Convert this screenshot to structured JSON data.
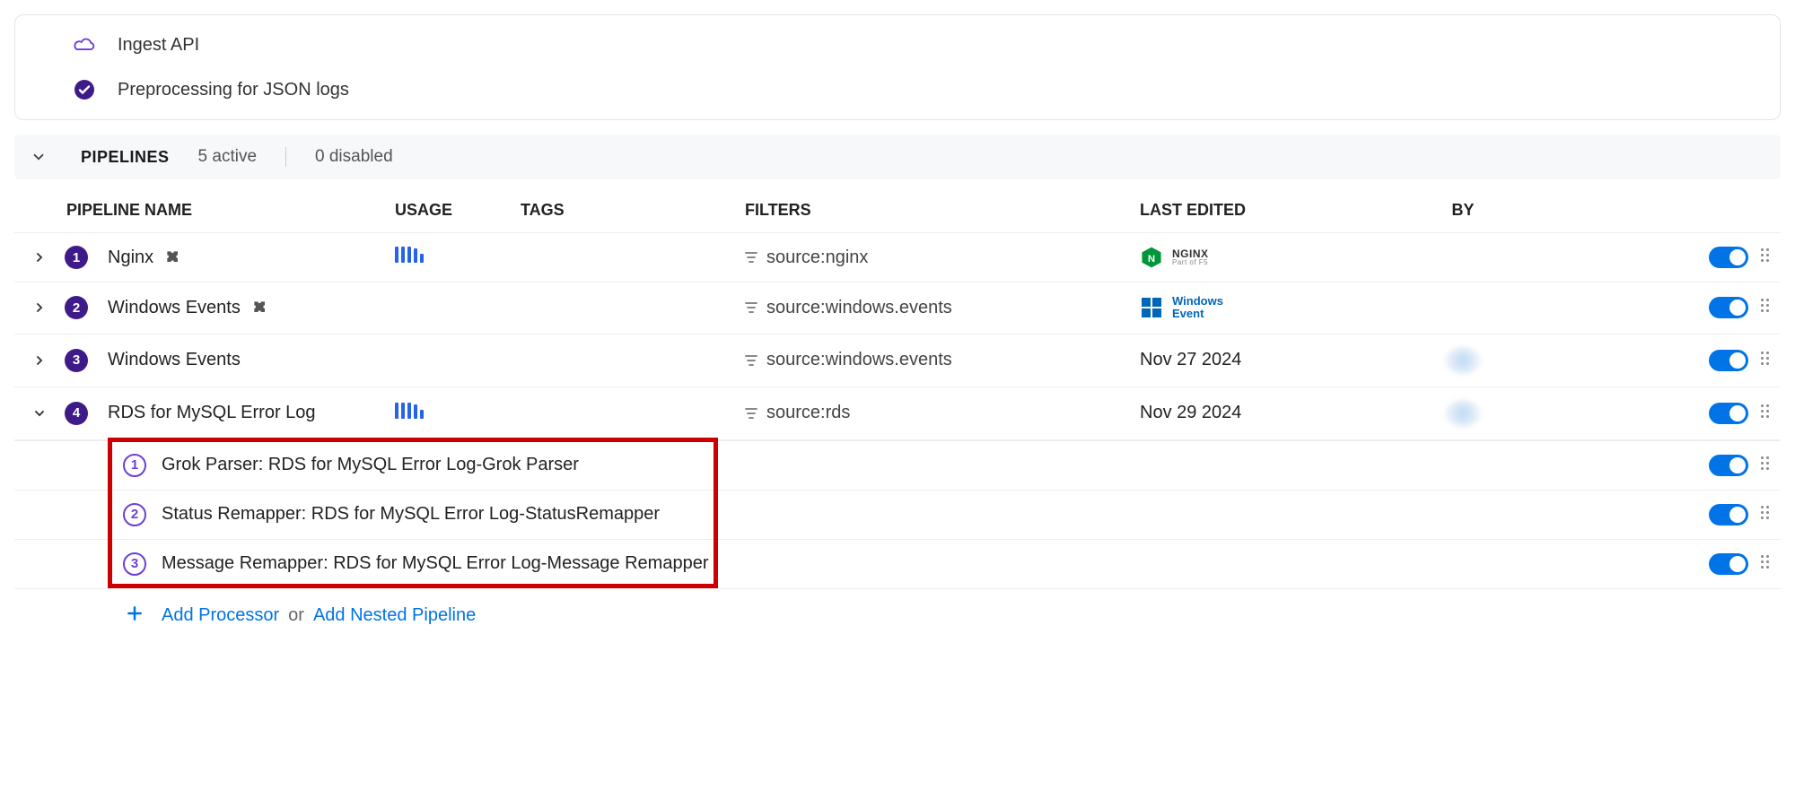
{
  "header": {
    "ingest_label": "Ingest API",
    "preproc_label": "Preprocessing for JSON logs"
  },
  "pipelines_bar": {
    "title": "PIPELINES",
    "active": "5 active",
    "disabled": "0 disabled"
  },
  "columns": {
    "name": "PIPELINE NAME",
    "usage": "USAGE",
    "tags": "TAGS",
    "filters": "FILTERS",
    "last_edited": "LAST EDITED",
    "by": "BY"
  },
  "rows": [
    {
      "num": "1",
      "name": "Nginx",
      "filter": "source:nginx",
      "logo": "nginx",
      "logo_text_main": "NGINX",
      "logo_text_sub": "Part of F5",
      "date": "",
      "usage": true,
      "puzzle": true,
      "avatar": false
    },
    {
      "num": "2",
      "name": "Windows Events",
      "filter": "source:windows.events",
      "logo": "windows",
      "logo_text_main": "Windows",
      "logo_text_sub": "Event",
      "date": "",
      "usage": false,
      "puzzle": true,
      "avatar": false
    },
    {
      "num": "3",
      "name": "Windows Events",
      "filter": "source:windows.events",
      "logo": "",
      "logo_text_main": "",
      "logo_text_sub": "",
      "date": "Nov 27 2024",
      "usage": false,
      "puzzle": false,
      "avatar": true
    },
    {
      "num": "4",
      "name": "RDS for MySQL Error Log",
      "filter": "source:rds",
      "logo": "",
      "logo_text_main": "",
      "logo_text_sub": "",
      "date": "Nov 29 2024",
      "usage": true,
      "puzzle": false,
      "avatar": true,
      "expanded": true
    }
  ],
  "sub_rows": [
    {
      "num": "1",
      "name": "Grok Parser: RDS for MySQL Error Log-Grok Parser"
    },
    {
      "num": "2",
      "name": "Status Remapper: RDS for MySQL Error Log-StatusRemapper"
    },
    {
      "num": "3",
      "name": "Message Remapper: RDS for MySQL Error Log-Message Remapper"
    }
  ],
  "add": {
    "processor": "Add Processor",
    "or": "or",
    "nested": "Add Nested Pipeline"
  }
}
